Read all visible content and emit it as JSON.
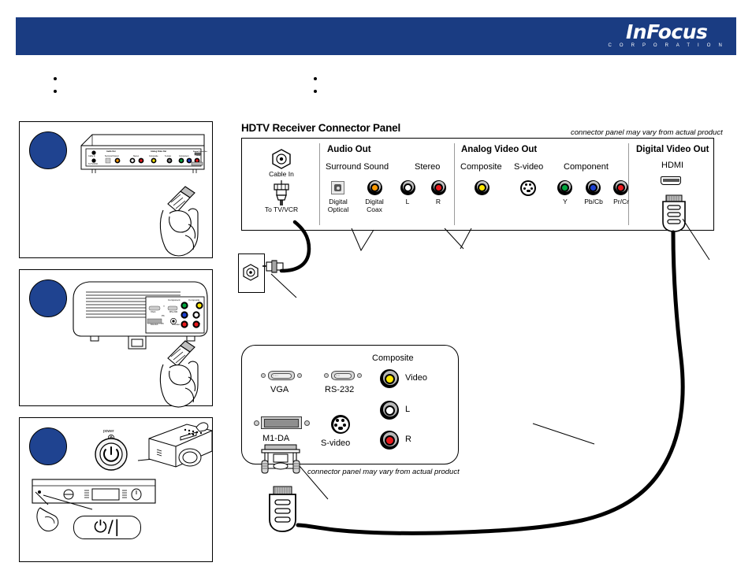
{
  "header": {
    "brand": "InFocus",
    "brand_sub": "C O R P O R A T I O N",
    "bar_color": "#1a3c82"
  },
  "bullets": {
    "left_column": [
      "",
      ""
    ],
    "right_column": [
      "",
      ""
    ]
  },
  "steps": [
    {
      "number": "",
      "caption": "",
      "illustration": "hdtv-receiver-with-hand-holding-cable"
    },
    {
      "number": "",
      "caption": "",
      "illustration": "projector-with-hand-holding-cable"
    },
    {
      "number": "",
      "caption": "",
      "illustration": "power-buttons-projector-and-receiver"
    }
  ],
  "step3_labels": {
    "power_small": "power",
    "power_standby": "⏻/|"
  },
  "receiver_panel": {
    "title": "HDTV Receiver Connector Panel",
    "vary_note": "connector panel may vary from actual product",
    "cable_section": {
      "cable_in": "Cable In",
      "to_tv_vcr": "To TV/VCR"
    },
    "audio_out": {
      "heading": "Audio Out",
      "groups": [
        {
          "label": "Surround Sound",
          "connectors": [
            {
              "label": "Digital\nOptical",
              "label_line1": "Digital",
              "label_line2": "Optical",
              "type": "optical",
              "color": "#cfcfcf"
            },
            {
              "label": "Digital\nCoax",
              "label_line1": "Digital",
              "label_line2": "Coax",
              "type": "rca",
              "color": "#ff9900"
            }
          ]
        },
        {
          "label": "Stereo",
          "connectors": [
            {
              "label": "L",
              "type": "rca",
              "color": "#ffffff"
            },
            {
              "label": "R",
              "type": "rca",
              "color": "#e8191c"
            }
          ]
        }
      ]
    },
    "analog_video_out": {
      "heading": "Analog Video Out",
      "groups": [
        {
          "label": "Composite",
          "connectors": [
            {
              "label": "",
              "type": "rca",
              "color": "#ffe800"
            }
          ]
        },
        {
          "label": "S-video",
          "connectors": [
            {
              "label": "",
              "type": "svideo",
              "color": "#000000"
            }
          ]
        },
        {
          "label": "Component",
          "connectors": [
            {
              "label": "Y",
              "type": "rca",
              "color": "#00a63f"
            },
            {
              "label": "Pb/Cb",
              "type": "rca",
              "color": "#1b3fd0"
            },
            {
              "label": "Pr/Cr",
              "type": "rca",
              "color": "#e8191c"
            }
          ]
        }
      ]
    },
    "digital_video_out": {
      "heading": "Digital Video Out",
      "connector_label": "HDMI",
      "connector_type": "hdmi-port"
    }
  },
  "projector_panel": {
    "vary_note": "connector panel may vary from actual product",
    "composite_group_label": "Composite",
    "connectors": [
      {
        "label": "VGA",
        "type": "dsub-hd15"
      },
      {
        "label": "RS-232",
        "type": "dsub-db9"
      },
      {
        "label": "M1-DA",
        "type": "m1-da"
      },
      {
        "label": "S-video",
        "type": "mini-din"
      }
    ],
    "composite_jacks": [
      {
        "label": "Video",
        "color": "#ffe800"
      },
      {
        "label": "L",
        "color": "#ffffff"
      },
      {
        "label": "R",
        "color": "#e8191c"
      }
    ]
  },
  "wall_plate": {
    "name": "coax-wall-outlet"
  },
  "cables": {
    "coax_cable": "coax-cable-from-wall-to-receiver",
    "hdmi_to_m1_cable": "hdmi-to-m1da-cable"
  },
  "colors": {
    "brand_blue": "#1a3c82",
    "step_blue": "#1f4390",
    "yellow": "#ffe800",
    "red": "#e8191c",
    "green": "#00a63f",
    "blue": "#1b3fd0",
    "orange": "#ff9900",
    "white": "#ffffff"
  }
}
